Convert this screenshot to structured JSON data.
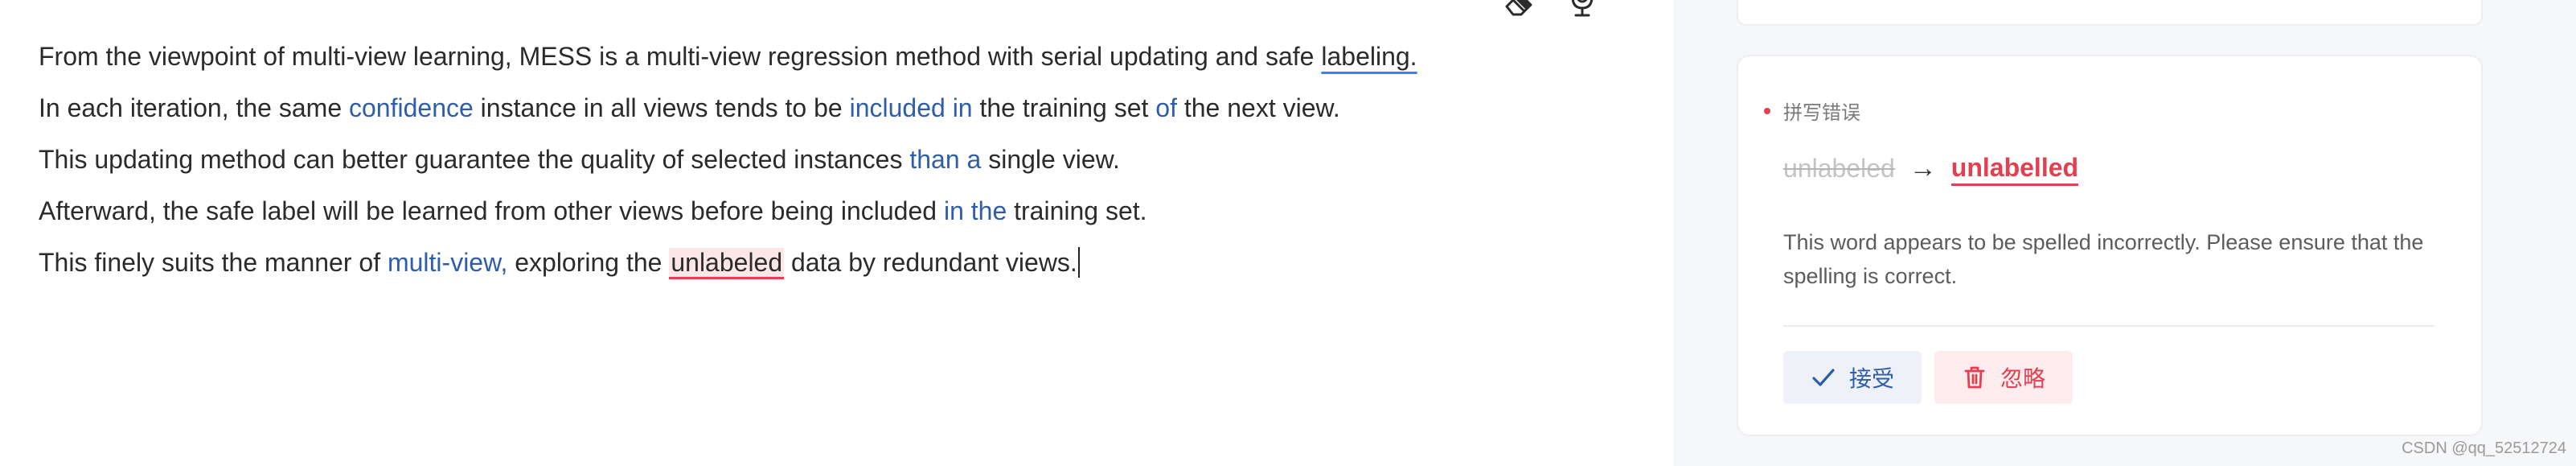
{
  "editor": {
    "line1": {
      "pre": "From the viewpoint of multi-view learning, MESS is a multi-view regression method with serial updating and safe ",
      "underlined": "labeling.",
      "post": ""
    },
    "line2": {
      "t1": "In each iteration, the same ",
      "h1": "confidence",
      "t2": " instance in all views tends to be ",
      "h2": "included in",
      "t3": " the training set ",
      "h3": "of",
      "t4": " the next view."
    },
    "line3": {
      "t1": "This updating method can better guarantee the quality of selected instances ",
      "h1": "than a",
      "t2": " single view."
    },
    "line4": {
      "t1": "Afterward, the safe label will be learned from other views before being included ",
      "h1": "in the",
      "t2": " training set."
    },
    "line5": {
      "t1": "This finely suits the manner of ",
      "h1": "multi-view,",
      "t2": " exploring the ",
      "err": "unlabeled",
      "t3": " data by redundant views."
    }
  },
  "toolbar": {
    "icons": [
      "eraser-icon",
      "microphone-icon"
    ]
  },
  "suggestion": {
    "category": "拼写错误",
    "original": "unlabeled",
    "arrow": "→",
    "replacement": "unlabelled",
    "description": "This word appears to be spelled incorrectly. Please ensure that the spelling is correct.",
    "accept_label": "接受",
    "ignore_label": "忽略"
  },
  "colors": {
    "highlight_blue": "#2f5ea8",
    "error_red": "#e0404f",
    "error_bg": "#fde6e8",
    "panel_bg": "#f6f7f9"
  },
  "watermark": "CSDN @qq_52512724"
}
